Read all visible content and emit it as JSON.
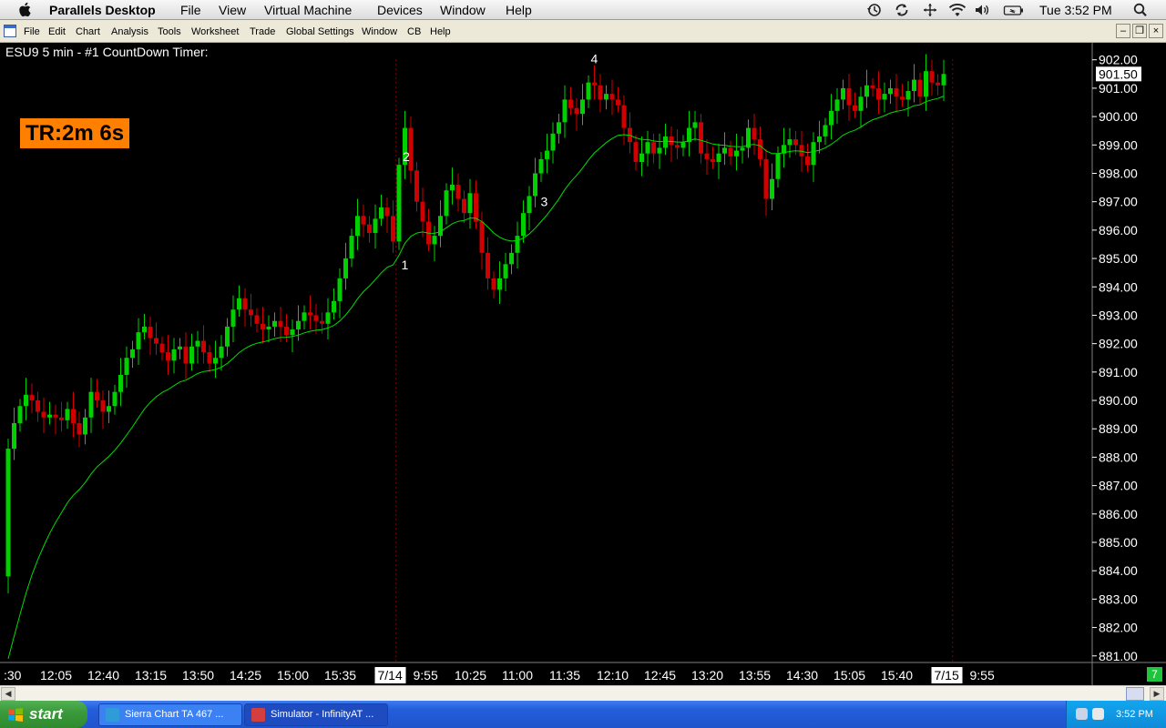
{
  "mac_menu": {
    "apple": "",
    "app_name": "Parallels Desktop",
    "items": [
      "File",
      "View",
      "Virtual Machine",
      "Devices",
      "Window",
      "Help"
    ],
    "clock": "Tue 3:52 PM",
    "status_icons": [
      "time-machine-icon",
      "sync-icon",
      "move-icon",
      "wifi-icon",
      "volume-icon",
      "battery-icon",
      "spotlight-icon"
    ]
  },
  "app_menu": {
    "items": [
      "File",
      "Edit",
      "Chart",
      "Analysis",
      "Tools",
      "Worksheet",
      "Trade",
      "Global Settings",
      "Window",
      "CB",
      "Help"
    ],
    "window_controls": [
      "minimize",
      "restore",
      "close"
    ],
    "window_glyphs": [
      "–",
      "❐",
      "×"
    ]
  },
  "chart": {
    "title": "ESU9  5 min  - #1  CountDown Timer:",
    "timer_label": "TR:2m 6s",
    "last_price": "901.50",
    "counter_badge": "7",
    "colors": {
      "up": "#00d000",
      "down": "#d00000",
      "ma": "#00dd00",
      "background": "#000000",
      "timer_bg": "#ff7f00"
    },
    "annotations": [
      {
        "text": "1",
        "bar": 67
      },
      {
        "text": "2",
        "bar": 66
      },
      {
        "text": "3",
        "bar": 89
      },
      {
        "text": "4",
        "bar": 99
      }
    ]
  },
  "chart_data": {
    "type": "candlestick",
    "symbol": "ESU9",
    "interval": "5 min",
    "ylim": [
      880.8,
      902.6
    ],
    "y_ticks": [
      "902.00",
      "901.00",
      "900.00",
      "899.00",
      "898.00",
      "897.00",
      "896.00",
      "895.00",
      "894.00",
      "893.00",
      "892.00",
      "891.00",
      "890.00",
      "889.00",
      "888.00",
      "887.00",
      "886.00",
      "885.00",
      "884.00",
      "883.00",
      "882.00",
      "881.00"
    ],
    "x_ticks": [
      {
        "label": ":30",
        "bar": 0,
        "highlight": false
      },
      {
        "label": "12:05",
        "bar": 8,
        "highlight": false
      },
      {
        "label": "12:40",
        "bar": 16,
        "highlight": false
      },
      {
        "label": "13:15",
        "bar": 24,
        "highlight": false
      },
      {
        "label": "13:50",
        "bar": 32,
        "highlight": false
      },
      {
        "label": "14:25",
        "bar": 40,
        "highlight": false
      },
      {
        "label": "15:00",
        "bar": 48,
        "highlight": false
      },
      {
        "label": "15:35",
        "bar": 56,
        "highlight": false
      },
      {
        "label": "7/14",
        "bar": 65,
        "highlight": true
      },
      {
        "label": "9:55",
        "bar": 71,
        "highlight": false
      },
      {
        "label": "10:25",
        "bar": 78,
        "highlight": false
      },
      {
        "label": "11:00",
        "bar": 86,
        "highlight": false
      },
      {
        "label": "11:35",
        "bar": 94,
        "highlight": false
      },
      {
        "label": "12:10",
        "bar": 102,
        "highlight": false
      },
      {
        "label": "12:45",
        "bar": 110,
        "highlight": false
      },
      {
        "label": "13:20",
        "bar": 118,
        "highlight": false
      },
      {
        "label": "13:55",
        "bar": 126,
        "highlight": false
      },
      {
        "label": "14:30",
        "bar": 134,
        "highlight": false
      },
      {
        "label": "15:05",
        "bar": 142,
        "highlight": false
      },
      {
        "label": "15:40",
        "bar": 150,
        "highlight": false
      },
      {
        "label": "7/15",
        "bar": 159,
        "highlight": true
      },
      {
        "label": "9:55",
        "bar": 165,
        "highlight": false
      }
    ],
    "session_breaks": [
      65.5,
      159.5
    ],
    "close": [
      888.3,
      889.2,
      889.8,
      890.2,
      890.0,
      889.6,
      889.4,
      889.5,
      889.4,
      889.3,
      889.7,
      889.2,
      888.8,
      889.4,
      890.3,
      890.0,
      889.6,
      889.8,
      890.3,
      890.9,
      891.5,
      891.8,
      892.4,
      892.6,
      892.2,
      892.0,
      891.7,
      891.4,
      891.8,
      891.9,
      891.3,
      891.9,
      892.1,
      891.7,
      891.3,
      891.5,
      891.9,
      892.6,
      893.2,
      893.6,
      893.2,
      893.0,
      892.7,
      892.5,
      892.6,
      892.8,
      892.6,
      892.3,
      892.5,
      892.8,
      893.1,
      893.0,
      892.8,
      892.7,
      893.1,
      893.5,
      894.3,
      895.0,
      895.8,
      896.5,
      896.2,
      895.9,
      896.4,
      896.8,
      896.5,
      895.6,
      898.3,
      899.6,
      898.1,
      897.0,
      896.3,
      895.5,
      895.8,
      896.5,
      897.4,
      897.6,
      897.1,
      896.6,
      897.3,
      896.3,
      895.2,
      894.3,
      893.9,
      894.3,
      894.8,
      895.2,
      895.8,
      896.6,
      897.2,
      898.0,
      898.5,
      898.8,
      899.4,
      899.8,
      900.6,
      900.3,
      900.1,
      900.6,
      901.2,
      901.1,
      900.6,
      900.8,
      900.6,
      900.4,
      899.6,
      899.1,
      898.4,
      898.7,
      899.1,
      898.7,
      898.9,
      899.3,
      899.0,
      898.9,
      899.1,
      899.6,
      899.8,
      898.7,
      898.5,
      898.4,
      898.7,
      898.9,
      898.6,
      898.8,
      898.9,
      899.6,
      899.2,
      898.5,
      897.1,
      897.8,
      898.7,
      899.0,
      899.2,
      899.0,
      898.6,
      898.3,
      899.1,
      899.3,
      899.7,
      900.2,
      900.6,
      901.0,
      900.4,
      900.2,
      900.7,
      901.1,
      901.0,
      900.6,
      900.8,
      901.0,
      900.7,
      900.6,
      900.9,
      901.3,
      900.7,
      901.6,
      901.2,
      901.1,
      901.5
    ],
    "series": [
      {
        "name": "",
        "type": "moving-average"
      }
    ]
  }
}
